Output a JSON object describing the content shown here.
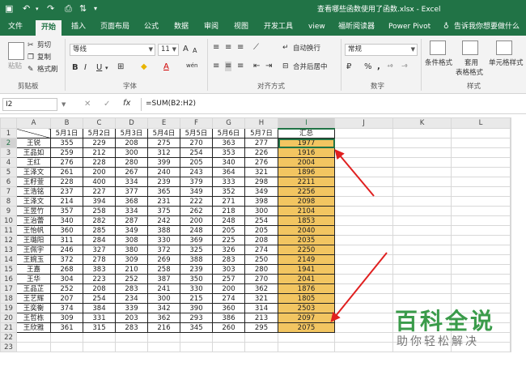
{
  "titlebar": {
    "save_icon": "save-icon",
    "undo_icon": "undo-icon",
    "redo_icon": "redo-icon",
    "title": "查看哪些函数使用了函数.xlsx - Excel"
  },
  "tabs": [
    "文件",
    "开始",
    "插入",
    "页面布局",
    "公式",
    "数据",
    "审阅",
    "视图",
    "开发工具",
    "view",
    "福昕阅读器",
    "Power Pivot"
  ],
  "active_tab": "开始",
  "tell_me": "告诉我你想要做什么",
  "ribbon": {
    "clipboard": {
      "paste": "粘贴",
      "cut": "剪切",
      "copy": "复制",
      "format_painter": "格式刷",
      "label": "剪贴板"
    },
    "font": {
      "name": "等线",
      "size": "11",
      "bold": "B",
      "italic": "I",
      "underline": "U",
      "label": "字体",
      "grow": "A",
      "shrink": "A",
      "wen": "wén"
    },
    "alignment": {
      "wrap": "自动换行",
      "merge": "合并后居中",
      "label": "对齐方式"
    },
    "number": {
      "format": "常规",
      "percent": "%",
      "comma": ",",
      "label": "数字"
    },
    "styles": {
      "conditional": "条件格式",
      "table_fmt_1": "套用",
      "table_fmt_2": "表格格式",
      "cell_styles": "单元格样式",
      "label": "样式"
    }
  },
  "formula_bar": {
    "name_box": "I2",
    "cancel": "✕",
    "enter": "✓",
    "fx": "fx",
    "formula": "=SUM(B2:H2)"
  },
  "columns": [
    "A",
    "B",
    "C",
    "D",
    "E",
    "F",
    "G",
    "H",
    "I",
    "J",
    "K",
    "L"
  ],
  "header_row": [
    "",
    "5月1日",
    "5月2日",
    "5月3日",
    "5月4日",
    "5月5日",
    "5月6日",
    "5月7日",
    "汇总"
  ],
  "rows": [
    [
      "王锐",
      "355",
      "229",
      "208",
      "275",
      "270",
      "363",
      "277",
      "1977"
    ],
    [
      "王品如",
      "259",
      "212",
      "300",
      "312",
      "254",
      "353",
      "226",
      "1916"
    ],
    [
      "王红",
      "276",
      "228",
      "280",
      "399",
      "205",
      "340",
      "276",
      "2004"
    ],
    [
      "王泽文",
      "261",
      "200",
      "267",
      "240",
      "243",
      "364",
      "321",
      "1896"
    ],
    [
      "王籽萱",
      "228",
      "400",
      "334",
      "239",
      "379",
      "333",
      "298",
      "2211"
    ],
    [
      "王浩铭",
      "237",
      "227",
      "377",
      "365",
      "349",
      "352",
      "349",
      "2256"
    ],
    [
      "王泽文",
      "214",
      "394",
      "368",
      "231",
      "222",
      "271",
      "398",
      "2098"
    ],
    [
      "王昱竹",
      "357",
      "258",
      "334",
      "375",
      "262",
      "218",
      "300",
      "2104"
    ],
    [
      "王治蕾",
      "340",
      "282",
      "287",
      "242",
      "200",
      "248",
      "254",
      "1853"
    ],
    [
      "王怡帆",
      "360",
      "285",
      "349",
      "388",
      "248",
      "205",
      "205",
      "2040"
    ],
    [
      "王璐阳",
      "311",
      "284",
      "308",
      "330",
      "369",
      "225",
      "208",
      "2035"
    ],
    [
      "王佩宇",
      "246",
      "327",
      "380",
      "372",
      "325",
      "326",
      "274",
      "2250"
    ],
    [
      "王婉玉",
      "372",
      "278",
      "309",
      "269",
      "388",
      "283",
      "250",
      "2149"
    ],
    [
      "王嘉",
      "268",
      "383",
      "210",
      "258",
      "239",
      "303",
      "280",
      "1941"
    ],
    [
      "王华",
      "304",
      "223",
      "252",
      "387",
      "350",
      "257",
      "270",
      "2041"
    ],
    [
      "王品芷",
      "252",
      "208",
      "283",
      "241",
      "330",
      "200",
      "362",
      "1876"
    ],
    [
      "王艺辉",
      "207",
      "254",
      "234",
      "300",
      "215",
      "274",
      "321",
      "1805"
    ],
    [
      "王奕衡",
      "374",
      "384",
      "339",
      "342",
      "390",
      "360",
      "314",
      "2503"
    ],
    [
      "王哲栋",
      "309",
      "331",
      "203",
      "362",
      "293",
      "386",
      "213",
      "2097"
    ],
    [
      "王欣雅",
      "361",
      "315",
      "283",
      "216",
      "345",
      "260",
      "295",
      "2075"
    ]
  ],
  "extra_row_numbers": [
    "22",
    "23"
  ],
  "watermark": {
    "main": "百科全说",
    "sub": "助你轻松解决"
  },
  "colors": {
    "brand": "#217346",
    "total_fill": "#f2c561",
    "arrow": "#e02020",
    "watermark": "#3a9b4a"
  }
}
